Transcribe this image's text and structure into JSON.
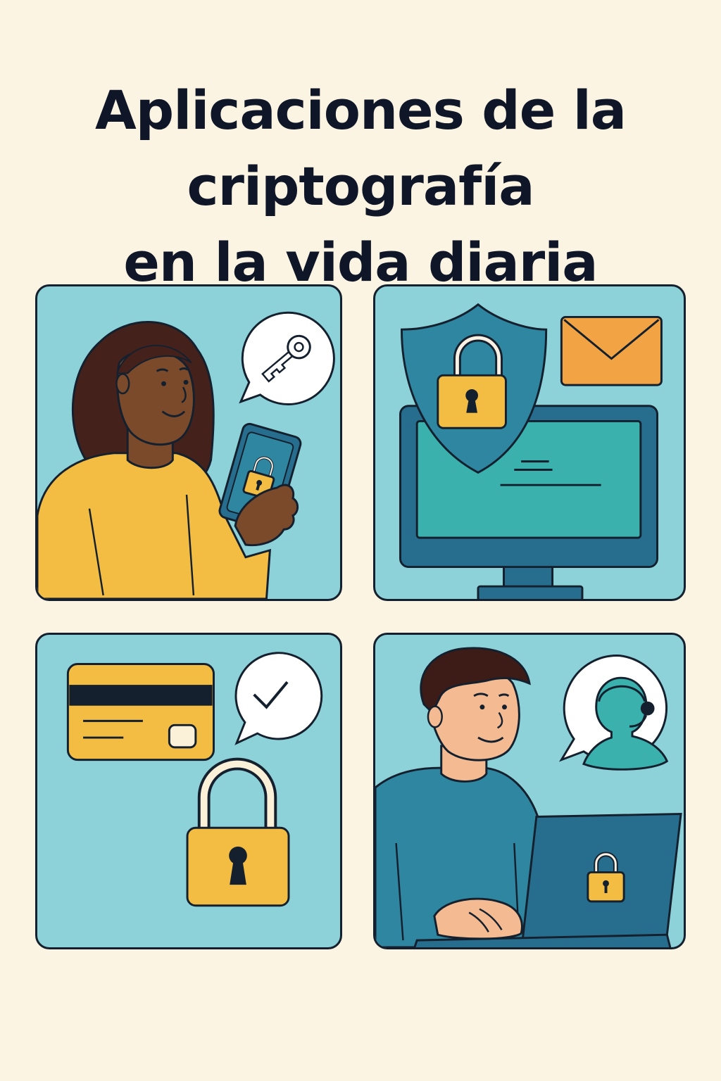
{
  "title": {
    "line1": "Aplicaciones de la",
    "line2": "criptografía",
    "line3": "en la vida diaria"
  },
  "colors": {
    "background": "#fcf4e2",
    "panel": "#8dd2d9",
    "outline": "#15202e",
    "yellow": "#f3bd44",
    "dark_teal": "#2f86a0",
    "navy_blue": "#276e8e",
    "screen_green": "#3bb1ad",
    "envelope_orange": "#f2a445",
    "skin_dark": "#7a4a2b",
    "hair_dark": "#45211c",
    "skin_light": "#f4bb92",
    "hair_brown": "#3d1c17"
  },
  "panels": [
    {
      "id": "phone-security",
      "icons": [
        "woman-avatar",
        "smartphone-icon",
        "padlock-icon",
        "speech-bubble-icon",
        "key-icon"
      ]
    },
    {
      "id": "computer-security",
      "icons": [
        "shield-icon",
        "padlock-icon",
        "envelope-icon",
        "monitor-icon"
      ]
    },
    {
      "id": "payment-security",
      "icons": [
        "credit-card-icon",
        "speech-bubble-icon",
        "checkmark-icon",
        "padlock-icon"
      ]
    },
    {
      "id": "laptop-support",
      "icons": [
        "man-avatar",
        "laptop-icon",
        "padlock-icon",
        "speech-bubble-icon",
        "support-agent-icon"
      ]
    }
  ]
}
